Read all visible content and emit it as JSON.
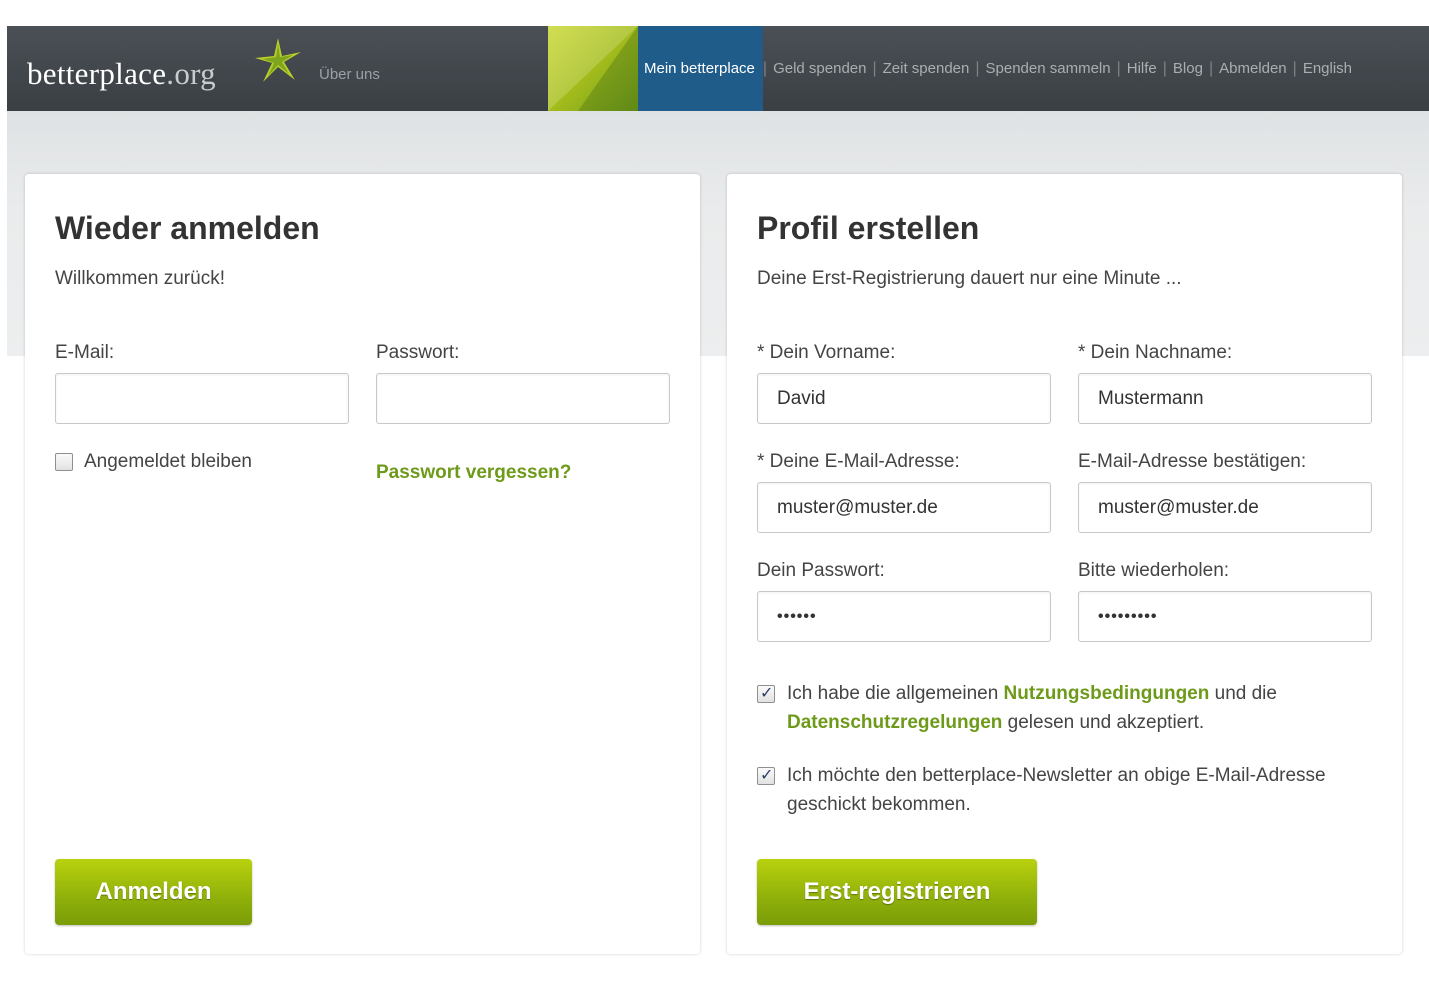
{
  "header": {
    "logo_main": "betterplace",
    "logo_tld": ".org",
    "about": "Über uns",
    "nav": [
      {
        "label": "Mein betterplace",
        "active": true
      },
      {
        "label": "Geld spenden"
      },
      {
        "label": "Zeit spenden"
      },
      {
        "label": "Spenden sammeln"
      },
      {
        "label": "Hilfe"
      },
      {
        "label": "Blog"
      },
      {
        "label": "Abmelden"
      },
      {
        "label": "English"
      }
    ],
    "separator": "|"
  },
  "login": {
    "title": "Wieder anmelden",
    "subtitle": "Willkommen zurück!",
    "email_label": "E-Mail:",
    "email_value": "",
    "password_label": "Passwort:",
    "password_value": "",
    "remember_label": "Angemeldet bleiben",
    "remember_checked": false,
    "forgot_link": "Passwort vergessen?",
    "submit": "Anmelden"
  },
  "register": {
    "title": "Profil erstellen",
    "subtitle": "Deine Erst-Registrierung dauert nur eine Minute ...",
    "firstname_label": "* Dein Vorname:",
    "firstname_value": "David",
    "lastname_label": "* Dein Nachname:",
    "lastname_value": "Mustermann",
    "email_label": "* Deine E-Mail-Adresse:",
    "email_value": "muster@muster.de",
    "email_confirm_label": "E-Mail-Adresse bestätigen:",
    "email_confirm_value": "muster@muster.de",
    "password_label": "Dein Passwort:",
    "password_value": "••••••",
    "password_repeat_label": "Bitte wiederholen:",
    "password_repeat_value": "•••••••••",
    "terms_text_1": "Ich habe die allgemeinen",
    "terms_link_1": "Nutzungsbedingungen",
    "terms_text_2": "und die",
    "terms_link_2": "Datenschutzregelungen",
    "terms_text_3": "gelesen und akzeptiert.",
    "terms_checked": true,
    "newsletter_text": "Ich möchte den betterplace-Newsletter an obige E-Mail-Adresse geschickt bekommen.",
    "newsletter_checked": true,
    "submit": "Erst-registrieren"
  },
  "colors": {
    "header_bg": "#3f4449",
    "nav_active_bg": "#1f5c8a",
    "accent_green": "#6e9a1a",
    "button_green": "#8fb00a"
  }
}
